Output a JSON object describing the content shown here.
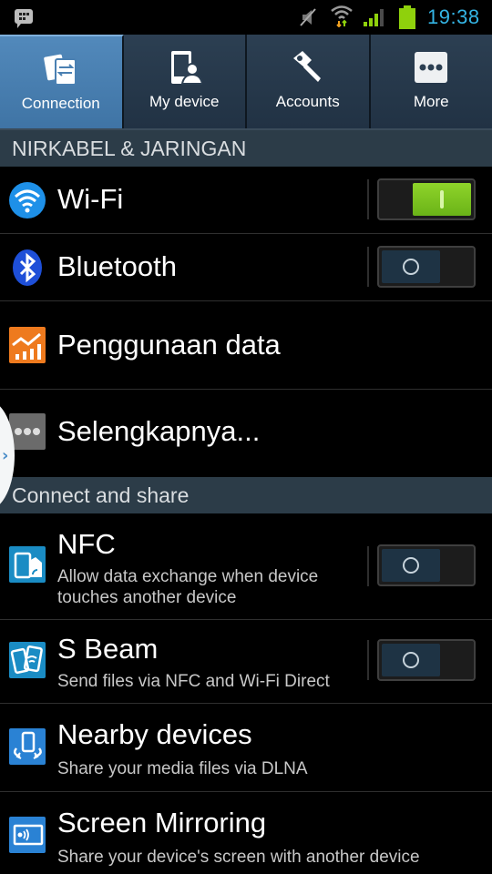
{
  "status_bar": {
    "notification_icon": "bbm-message-icon",
    "icons": [
      "mute-icon",
      "wifi-icon",
      "signal-icon",
      "battery-icon"
    ],
    "time": "19:38",
    "time_color": "#34b4e4"
  },
  "tabs": [
    {
      "label": "Connection",
      "icon": "connection-icon",
      "active": true
    },
    {
      "label": "My device",
      "icon": "my-device-icon",
      "active": false
    },
    {
      "label": "Accounts",
      "icon": "accounts-key-icon",
      "active": false
    },
    {
      "label": "More",
      "icon": "more-dots-icon",
      "active": false
    }
  ],
  "sections": [
    {
      "header": "NIRKABEL & JARINGAN",
      "items": [
        {
          "title": "Wi-Fi",
          "icon": "wifi-icon",
          "toggle": "on"
        },
        {
          "title": "Bluetooth",
          "icon": "bluetooth-icon",
          "toggle": "off"
        },
        {
          "title": "Penggunaan data",
          "icon": "data-usage-icon"
        },
        {
          "title": "Selengkapnya...",
          "icon": "more-networks-icon"
        }
      ]
    },
    {
      "header": "Connect and share",
      "items": [
        {
          "title": "NFC",
          "subtitle": "Allow data exchange when device touches another device",
          "icon": "nfc-icon",
          "toggle": "off"
        },
        {
          "title": "S Beam",
          "subtitle": "Send files via NFC and Wi-Fi Direct",
          "icon": "s-beam-icon",
          "toggle": "off"
        },
        {
          "title": "Nearby devices",
          "subtitle": "Share your media files via DLNA",
          "icon": "nearby-devices-icon"
        },
        {
          "title": "Screen Mirroring",
          "subtitle": "Share your device's screen with another device",
          "icon": "screen-mirroring-icon"
        }
      ]
    }
  ],
  "colors": {
    "toggle_on": "#7ac520",
    "toggle_off": "#1e3344",
    "active_tab": "#4a80b2",
    "section_header_bg": "#2c3c48"
  }
}
